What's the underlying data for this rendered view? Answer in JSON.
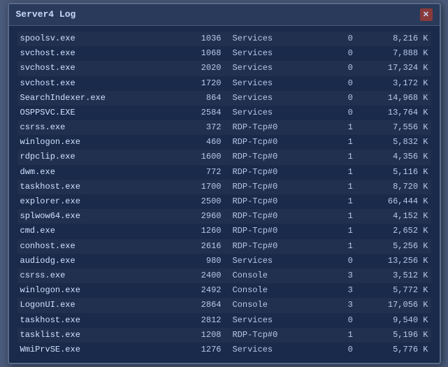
{
  "window": {
    "title": "Server4 Log",
    "close_label": "✕"
  },
  "processes": [
    {
      "name": "spoolsv.exe",
      "pid": 1036,
      "session": "Services",
      "num": 0,
      "mem": "8,216 K"
    },
    {
      "name": "svchost.exe",
      "pid": 1068,
      "session": "Services",
      "num": 0,
      "mem": "7,888 K"
    },
    {
      "name": "svchost.exe",
      "pid": 2020,
      "session": "Services",
      "num": 0,
      "mem": "17,324 K"
    },
    {
      "name": "svchost.exe",
      "pid": 1720,
      "session": "Services",
      "num": 0,
      "mem": "3,172 K"
    },
    {
      "name": "SearchIndexer.exe",
      "pid": 864,
      "session": "Services",
      "num": 0,
      "mem": "14,968 K"
    },
    {
      "name": "OSPPSVC.EXE",
      "pid": 2584,
      "session": "Services",
      "num": 0,
      "mem": "13,764 K"
    },
    {
      "name": "csrss.exe",
      "pid": 372,
      "session": "RDP-Tcp#0",
      "num": 1,
      "mem": "7,556 K"
    },
    {
      "name": "winlogon.exe",
      "pid": 460,
      "session": "RDP-Tcp#0",
      "num": 1,
      "mem": "5,832 K"
    },
    {
      "name": "rdpclip.exe",
      "pid": 1600,
      "session": "RDP-Tcp#0",
      "num": 1,
      "mem": "4,356 K"
    },
    {
      "name": "dwm.exe",
      "pid": 772,
      "session": "RDP-Tcp#0",
      "num": 1,
      "mem": "5,116 K"
    },
    {
      "name": "taskhost.exe",
      "pid": 1700,
      "session": "RDP-Tcp#0",
      "num": 1,
      "mem": "8,720 K"
    },
    {
      "name": "explorer.exe",
      "pid": 2500,
      "session": "RDP-Tcp#0",
      "num": 1,
      "mem": "66,444 K"
    },
    {
      "name": "splwow64.exe",
      "pid": 2960,
      "session": "RDP-Tcp#0",
      "num": 1,
      "mem": "4,152 K"
    },
    {
      "name": "cmd.exe",
      "pid": 1260,
      "session": "RDP-Tcp#0",
      "num": 1,
      "mem": "2,652 K"
    },
    {
      "name": "conhost.exe",
      "pid": 2616,
      "session": "RDP-Tcp#0",
      "num": 1,
      "mem": "5,256 K"
    },
    {
      "name": "audiodg.exe",
      "pid": 980,
      "session": "Services",
      "num": 0,
      "mem": "13,256 K"
    },
    {
      "name": "csrss.exe",
      "pid": 2400,
      "session": "Console",
      "num": 3,
      "mem": "3,512 K"
    },
    {
      "name": "winlogon.exe",
      "pid": 2492,
      "session": "Console",
      "num": 3,
      "mem": "5,772 K"
    },
    {
      "name": "LogonUI.exe",
      "pid": 2864,
      "session": "Console",
      "num": 3,
      "mem": "17,056 K"
    },
    {
      "name": "taskhost.exe",
      "pid": 2812,
      "session": "Services",
      "num": 0,
      "mem": "9,540 K"
    },
    {
      "name": "tasklist.exe",
      "pid": 1208,
      "session": "RDP-Tcp#0",
      "num": 1,
      "mem": "5,196 K"
    },
    {
      "name": "WmiPrvSE.exe",
      "pid": 1276,
      "session": "Services",
      "num": 0,
      "mem": "5,776 K"
    }
  ]
}
